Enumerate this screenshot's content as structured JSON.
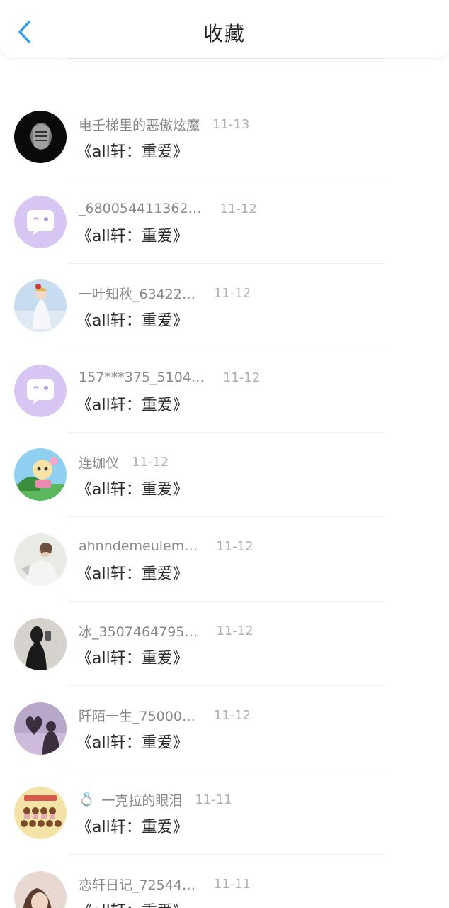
{
  "header": {
    "title": "收藏"
  },
  "book_title": "《all轩：重爱》",
  "items": [
    {
      "username": "",
      "date": ""
    },
    {
      "username": "电壬梯里的恶傲炫魔",
      "date": "11-13"
    },
    {
      "username": "_680054411362…",
      "date": "11-12"
    },
    {
      "username": "一叶知秋_63422…",
      "date": "11-12"
    },
    {
      "username": "157***375_5104…",
      "date": "11-12"
    },
    {
      "username": "连珈仪",
      "date": "11-12"
    },
    {
      "username": "ahnndemeulem…",
      "date": "11-12"
    },
    {
      "username": "冰_3507464795…",
      "date": "11-12"
    },
    {
      "username": "阡陌一生_75000…",
      "date": "11-12"
    },
    {
      "username": "一克拉的眼泪",
      "date": "11-11",
      "badge_icon": "ring-icon"
    },
    {
      "username": "恋轩日记_72544…",
      "date": "11-11"
    }
  ],
  "colors": {
    "accent": "#2f9bf0",
    "default_avatar": "#d7c6f3"
  }
}
